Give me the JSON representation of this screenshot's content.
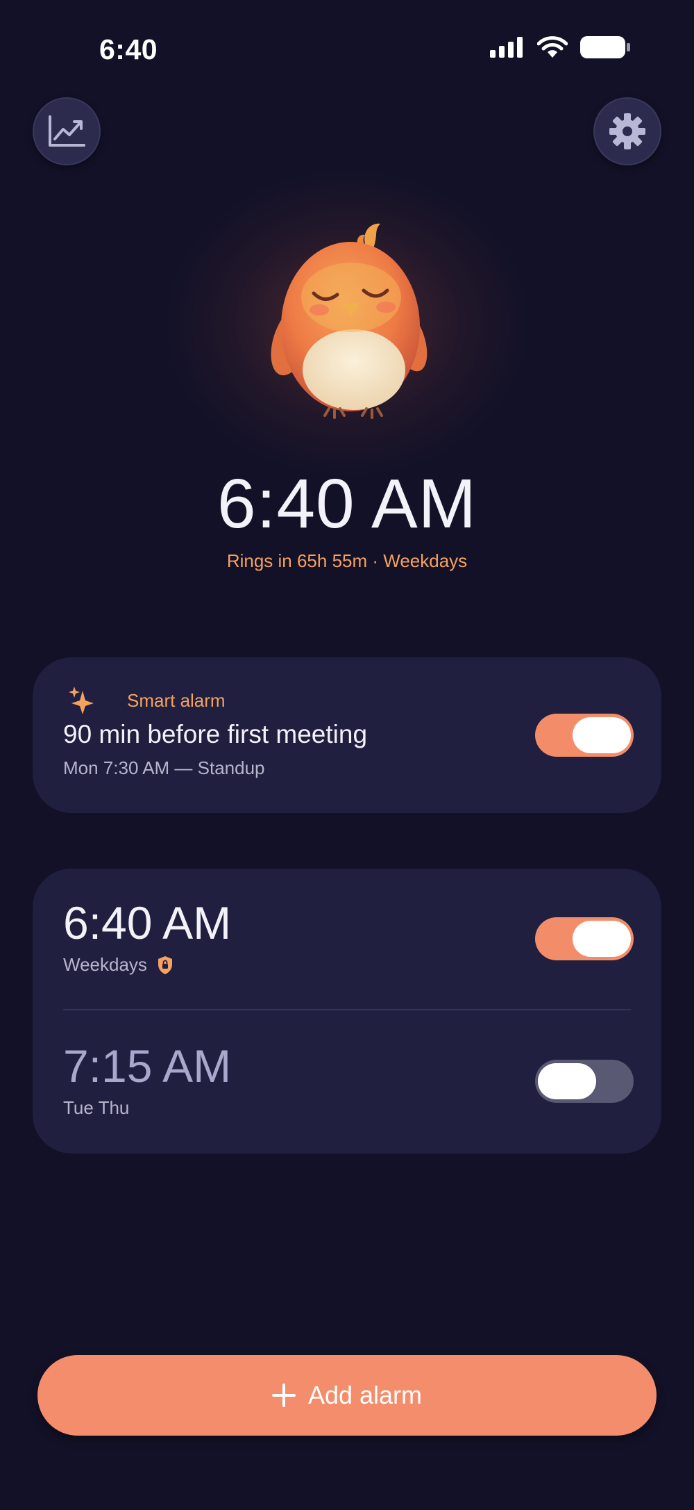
{
  "status_bar": {
    "time": "6:40"
  },
  "header": {
    "stats_icon": "chart-line-icon",
    "settings_icon": "gear-icon"
  },
  "hero": {
    "mascot": "sleeping-bird-mascot",
    "time": "6:40 AM",
    "subtitle": "Rings in 65h 55m · Weekdays"
  },
  "smart_alarm": {
    "label": "Smart alarm",
    "title": "90 min before first meeting",
    "subtitle": "Mon 7:30 AM — Standup",
    "enabled": true,
    "icon": "sparkle-icon"
  },
  "alarms": [
    {
      "time": "6:40 AM",
      "days": "Weekdays",
      "locked": true,
      "enabled": true
    },
    {
      "time": "7:15 AM",
      "days": "Tue Thu",
      "locked": false,
      "enabled": false
    }
  ],
  "actions": {
    "add_label": "Add alarm"
  },
  "colors": {
    "background": "#121127",
    "card": "#201f3f",
    "accent": "#f38d69",
    "accent_text": "#f5a15f",
    "toggle_off": "#5a5973"
  }
}
